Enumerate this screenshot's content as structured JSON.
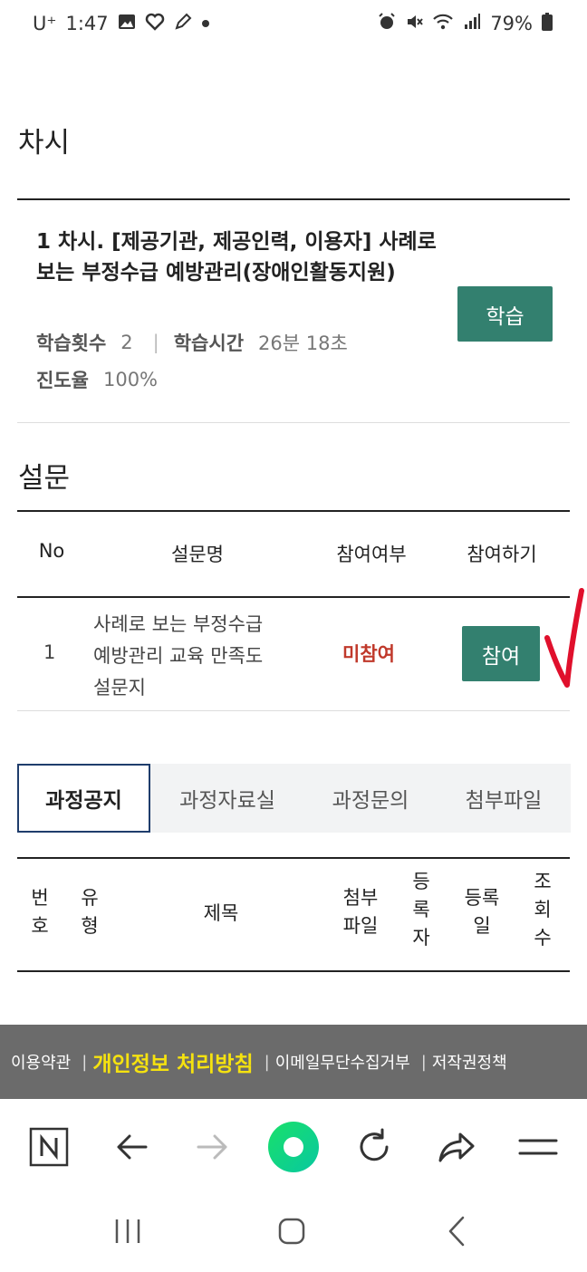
{
  "status_bar": {
    "carrier": "U⁺",
    "time": "1:47",
    "battery": "79%",
    "left_icons": [
      "image-icon",
      "heart-link-icon",
      "edit-icon",
      "dot-icon"
    ],
    "right_icons": [
      "alarm-icon",
      "mute-icon",
      "wifi-icon",
      "signal-icon",
      "battery-icon"
    ]
  },
  "lesson_section": {
    "title": "차시",
    "lesson_title": "1 차시. [제공기관, 제공인력, 이용자] 사례로 보는 부정수급 예방관리(장애인활동지원)",
    "count_label": "학습횟수",
    "count_value": "2",
    "time_label": "학습시간",
    "time_value": "26분 18초",
    "progress_label": "진도율",
    "progress_value": "100%",
    "study_button": "학습"
  },
  "survey_section": {
    "title": "설문",
    "headers": {
      "no": "No",
      "name": "설문명",
      "status": "참여여부",
      "action": "참여하기"
    },
    "rows": [
      {
        "no": "1",
        "name_lines": [
          "사례로 보는 부정수급",
          "예방관리 교육 만족도",
          "설문지"
        ],
        "status": "미참여",
        "action": "참여"
      }
    ]
  },
  "tabs": [
    "과정공지",
    "과정자료실",
    "과정문의",
    "첨부파일"
  ],
  "active_tab": "과정공지",
  "notice_table": {
    "headers": {
      "number": [
        "번",
        "호"
      ],
      "type": [
        "유",
        "형"
      ],
      "title": "제목",
      "attachment": [
        "첨부",
        "파일"
      ],
      "registrant": [
        "등",
        "록",
        "자"
      ],
      "reg_date": [
        "등록",
        "일"
      ],
      "views": [
        "조",
        "회",
        "수"
      ]
    }
  },
  "footer": {
    "terms": "이용약관",
    "privacy": "개인정보 처리방침",
    "email_refusal": "이메일무단수집거부",
    "copyright": "저작권정책"
  },
  "toolbar_icons": [
    "naver-n-icon",
    "back-arrow-icon",
    "forward-arrow-icon",
    "green-home-icon",
    "refresh-icon",
    "share-icon",
    "menu-icon"
  ],
  "colors": {
    "accent_green": "#33806f",
    "not_joined_red": "#c0392b",
    "footer_bg": "#6b6b6b",
    "footer_highlight": "#f5e20f",
    "active_tab_border": "#1f3d6c",
    "annotation_red": "#e0102c"
  }
}
